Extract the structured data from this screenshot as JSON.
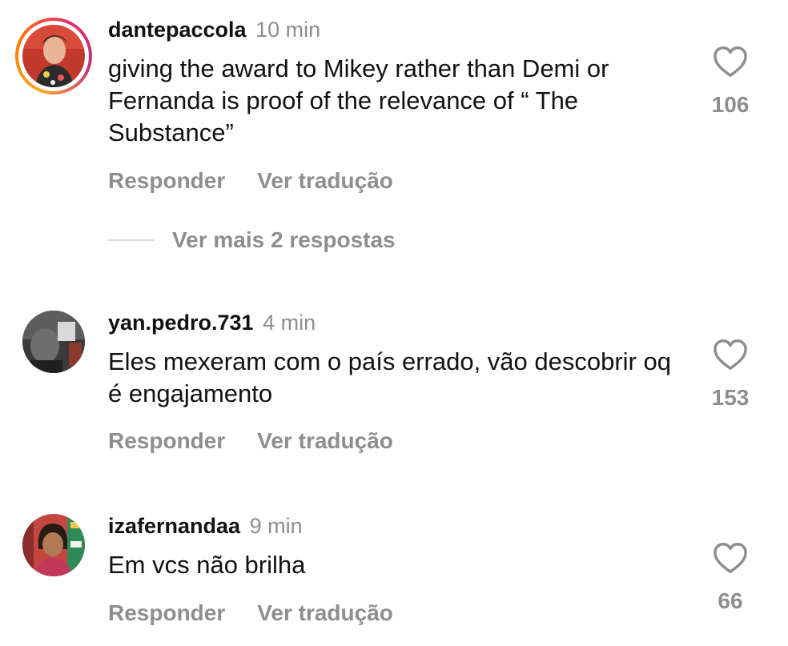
{
  "comments": [
    {
      "username": "dantepaccola",
      "time": "10 min",
      "text": "giving the award to Mikey rather than Demi or Fernanda is proof of the relevance of “ The Substance”",
      "reply_label": "Responder",
      "translate_label": "Ver tradução",
      "likes": "106",
      "more_replies_label": "Ver mais 2 respostas",
      "has_story_ring": true
    },
    {
      "username": "yan.pedro.731",
      "time": "4 min",
      "text": "Eles mexeram com o país errado, vão descobrir oq é engajamento",
      "reply_label": "Responder",
      "translate_label": "Ver tradução",
      "likes": "153",
      "has_story_ring": false
    },
    {
      "username": "izafernandaa",
      "time": "9 min",
      "text": "Em vcs não brilha",
      "reply_label": "Responder",
      "translate_label": "Ver tradução",
      "likes": "66",
      "has_story_ring": false
    }
  ],
  "icons": {
    "like": "heart-outline-icon"
  },
  "colors": {
    "secondary_text": "#8e8e8e",
    "primary_text": "#111111",
    "story_ring": "#e1306c"
  }
}
